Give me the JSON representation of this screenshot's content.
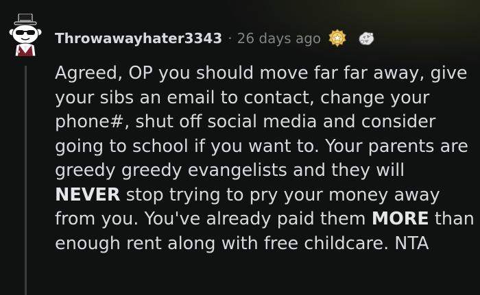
{
  "comment": {
    "username": "Throwawayhater3343",
    "separator": "·",
    "timestamp": "26 days ago",
    "awards": [
      "helpful-award-icon",
      "wholesome-seal-award-icon"
    ],
    "avatar": "snoo-avatar-top-hat-sunglasses",
    "body": {
      "seg1": "Agreed, OP you should move far far away, give your sibs an email to contact, change your phone#, shut off social media and consider going to school if you want to. Your parents are greedy greedy evangelists and they will ",
      "bold1": "NEVER",
      "seg2": " stop trying to pry your money away from you. You've already paid them ",
      "bold2": "MORE",
      "seg3": " than enough rent along with free childcare. NTA"
    }
  },
  "colors": {
    "background": "#101111",
    "text": "#d7dadc",
    "meta": "#818384",
    "thread_line": "#3a3c3d"
  }
}
